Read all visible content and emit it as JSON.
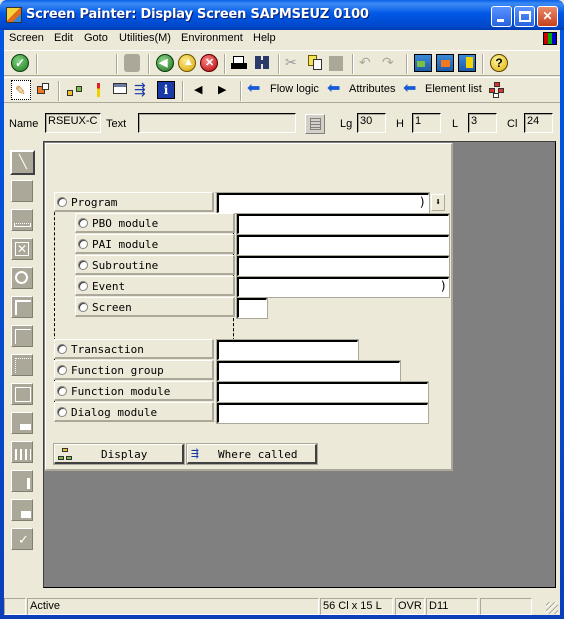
{
  "window": {
    "title": "Screen Painter:  Display Screen SAPMSEUZ 0100",
    "buttons": [
      "minimize",
      "maximize",
      "close"
    ]
  },
  "menubar": {
    "items": [
      "Screen",
      "Edit",
      "Goto",
      "Utilities(M)",
      "Environment",
      "Help"
    ]
  },
  "toolbar1": {
    "icons": [
      "enter-check",
      "save",
      "back",
      "exit",
      "cancel",
      "print",
      "find",
      "cut",
      "copy",
      "paste",
      "undo",
      "redo",
      "layout-1",
      "layout-2",
      "layout-3",
      "help"
    ]
  },
  "toolbar2": {
    "icons": [
      "layout-editor",
      "toggle-mode",
      "hierarchy",
      "wand",
      "screen-element",
      "where-used",
      "info",
      "previous",
      "next"
    ],
    "flow_logic": "Flow logic",
    "attributes": "Attributes",
    "element_list": "Element list"
  },
  "namebar": {
    "name_label": "Name",
    "name_value": "RSEUX-C",
    "text_label": "Text",
    "text_value": "",
    "lg_label": "Lg",
    "lg_value": "30",
    "h_label": "H",
    "h_value": "1",
    "l_label": "L",
    "l_value": "3",
    "cl_label": "Cl",
    "cl_value": "24"
  },
  "palette": {
    "items": [
      "pointer",
      "text-field",
      "input-field",
      "checkbox",
      "radio-button",
      "frame",
      "tabstrip",
      "tabstrip-wizard",
      "subscreen",
      "table-control",
      "table-control-columns",
      "table-control-wizard",
      "custom-control",
      "status-icon"
    ]
  },
  "screen": {
    "rows": [
      {
        "label": "Program",
        "level": 0
      },
      {
        "label": "PBO module",
        "level": 1
      },
      {
        "label": "PAI module",
        "level": 1
      },
      {
        "label": "Subroutine",
        "level": 1
      },
      {
        "label": "Event",
        "level": 1
      },
      {
        "label": "Screen",
        "level": 1
      },
      {
        "label": "Transaction",
        "level": 0
      },
      {
        "label": "Function group",
        "level": 0
      },
      {
        "label": "Function module",
        "level": 0
      },
      {
        "label": "Dialog module",
        "level": 0
      }
    ],
    "buttons": {
      "display": "Display",
      "where_called": "Where called"
    }
  },
  "statusbar": {
    "status": "Active",
    "size": "56 Cl x 15 L",
    "mode": "OVR",
    "system": "D11",
    "extra": ""
  }
}
